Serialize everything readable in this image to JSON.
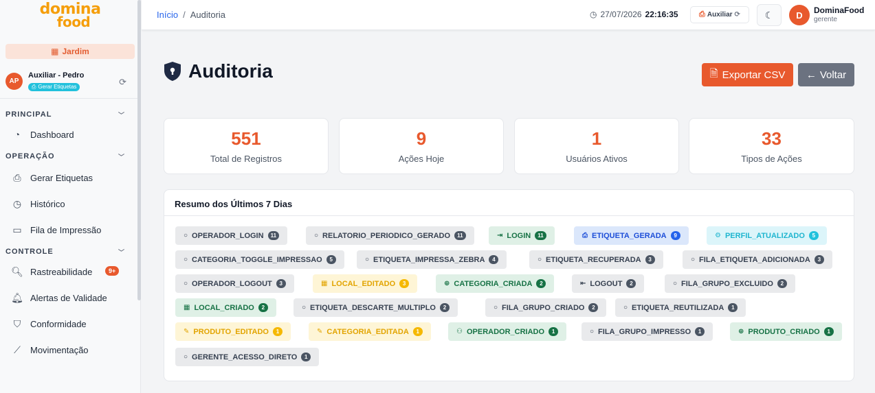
{
  "brand": {
    "line1": "domina",
    "line2": "food"
  },
  "store": {
    "label": "Jardim"
  },
  "operator": {
    "initials": "AP",
    "name": "Auxiliar - Pedro",
    "badge": "Gerar Etiquetas"
  },
  "sidebar": {
    "sections": [
      {
        "title": "PRINCIPAL",
        "items": [
          {
            "label": "Dashboard",
            "icon": "gauge-icon"
          }
        ]
      },
      {
        "title": "OPERAÇÃO",
        "items": [
          {
            "label": "Gerar Etiquetas",
            "icon": "printer-icon"
          },
          {
            "label": "Histórico",
            "icon": "clock-icon"
          },
          {
            "label": "Fila de Impressão",
            "icon": "window-icon"
          }
        ]
      },
      {
        "title": "CONTROLE",
        "items": [
          {
            "label": "Rastreabilidade",
            "icon": "search-icon",
            "badge": "9+"
          },
          {
            "label": "Alertas de Validade",
            "icon": "bell-icon"
          },
          {
            "label": "Conformidade",
            "icon": "shield-check-icon"
          },
          {
            "label": "Movimentação",
            "icon": "chart-line-icon"
          }
        ]
      }
    ]
  },
  "breadcrumb": {
    "home": "Início",
    "current": "Auditoria"
  },
  "topbar": {
    "date": "27/07/2026",
    "time": "22:16:35",
    "printer_label": "Auxiliar",
    "account_initial": "D",
    "account_name": "DominaFood",
    "account_role": "gerente"
  },
  "page": {
    "title": "Auditoria",
    "export_label": "Exportar CSV",
    "back_label": "Voltar"
  },
  "stats": [
    {
      "value": "551",
      "label": "Total de Registros"
    },
    {
      "value": "9",
      "label": "Ações Hoje"
    },
    {
      "value": "1",
      "label": "Usuários Ativos"
    },
    {
      "value": "33",
      "label": "Tipos de Ações"
    }
  ],
  "summary": {
    "title": "Resumo dos Últimos 7 Dias",
    "actions": [
      {
        "label": "OPERADOR_LOGIN",
        "count": "11",
        "color": "gray",
        "icon": "circle-icon"
      },
      {
        "label": "RELATORIO_PERIODICO_GERADO",
        "count": "11",
        "color": "gray",
        "icon": "circle-icon"
      },
      {
        "label": "LOGIN",
        "count": "11",
        "color": "green",
        "icon": "login-icon"
      },
      {
        "label": "ETIQUETA_GERADA",
        "count": "9",
        "color": "blue",
        "icon": "printer-icon"
      },
      {
        "label": "PERFIL_ATUALIZADO",
        "count": "5",
        "color": "cyan",
        "icon": "user-gear-icon"
      },
      {
        "label": "CATEGORIA_TOGGLE_IMPRESSAO",
        "count": "5",
        "color": "gray",
        "icon": "circle-icon"
      },
      {
        "label": "ETIQUETA_IMPRESSA_ZEBRA",
        "count": "4",
        "color": "gray",
        "icon": "circle-icon"
      },
      {
        "label": "ETIQUETA_RECUPERADA",
        "count": "3",
        "color": "gray",
        "icon": "circle-icon"
      },
      {
        "label": "FILA_ETIQUETA_ADICIONADA",
        "count": "3",
        "color": "gray",
        "icon": "circle-icon"
      },
      {
        "label": "OPERADOR_LOGOUT",
        "count": "3",
        "color": "gray",
        "icon": "circle-icon"
      },
      {
        "label": "LOCAL_EDITADO",
        "count": "3",
        "color": "yellow",
        "icon": "building-icon"
      },
      {
        "label": "CATEGORIA_CRIADA",
        "count": "2",
        "color": "green",
        "icon": "plus-circle-icon"
      },
      {
        "label": "LOGOUT",
        "count": "2",
        "color": "gray",
        "icon": "logout-icon"
      },
      {
        "label": "FILA_GRUPO_EXCLUIDO",
        "count": "2",
        "color": "gray",
        "icon": "circle-icon"
      },
      {
        "label": "LOCAL_CRIADO",
        "count": "2",
        "color": "green",
        "icon": "building-icon"
      },
      {
        "label": "ETIQUETA_DESCARTE_MULTIPLO",
        "count": "2",
        "color": "gray",
        "icon": "circle-icon"
      },
      {
        "label": "FILA_GRUPO_CRIADO",
        "count": "2",
        "color": "gray",
        "icon": "circle-icon"
      },
      {
        "label": "ETIQUETA_REUTILIZADA",
        "count": "1",
        "color": "gray",
        "icon": "circle-icon"
      },
      {
        "label": "PRODUTO_EDITADO",
        "count": "1",
        "color": "yellow",
        "icon": "pencil-icon"
      },
      {
        "label": "CATEGORIA_EDITADA",
        "count": "1",
        "color": "yellow",
        "icon": "pencil-icon"
      },
      {
        "label": "OPERADOR_CRIADO",
        "count": "1",
        "color": "green",
        "icon": "user-plus-icon"
      },
      {
        "label": "FILA_GRUPO_IMPRESSO",
        "count": "1",
        "color": "gray",
        "icon": "circle-icon"
      },
      {
        "label": "PRODUTO_CRIADO",
        "count": "1",
        "color": "green",
        "icon": "plus-circle-icon"
      },
      {
        "label": "GERENTE_ACESSO_DIRETO",
        "count": "1",
        "color": "gray",
        "icon": "circle-icon"
      }
    ]
  },
  "colors": {
    "accent": "#e8592d",
    "secondary": "#6b7280",
    "info": "#22c1dc"
  }
}
